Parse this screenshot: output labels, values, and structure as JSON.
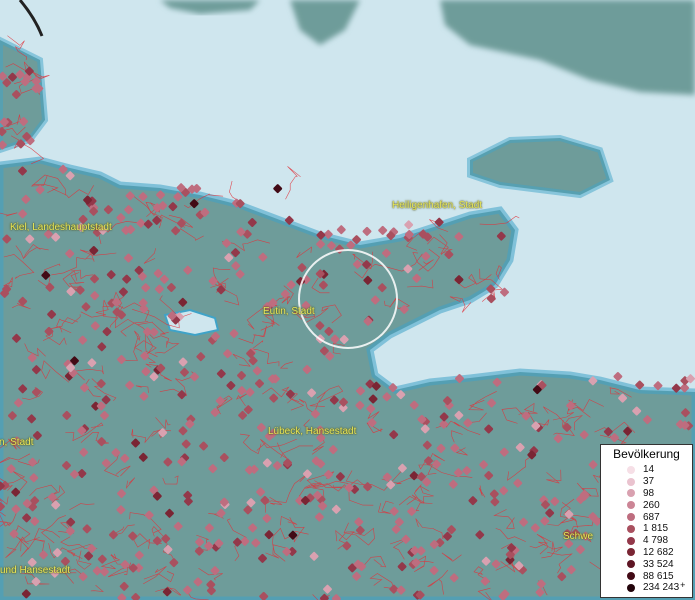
{
  "map": {
    "cities": [
      {
        "label": "Heiligenhafen, Stadt"
      },
      {
        "label": "Kiel, Landeshauptstadt"
      },
      {
        "label": "Eutin, Stadt"
      },
      {
        "label": "Lübeck, Hansestadt"
      },
      {
        "label": "n, Stadt"
      },
      {
        "label": "und Hansestadt"
      },
      {
        "label": "Schwe"
      }
    ],
    "colors": {
      "sea": "#cfe6ee",
      "land": "#6e9c9a",
      "boundary": "#e0323a",
      "marker": "#c9707f"
    }
  },
  "legend": {
    "title": "Bevölkerung",
    "items": [
      {
        "label": "14",
        "color": "#f6dfe6"
      },
      {
        "label": "37",
        "color": "#eac3cf"
      },
      {
        "label": "98",
        "color": "#d9a1b0"
      },
      {
        "label": "260",
        "color": "#cc8596"
      },
      {
        "label": "687",
        "color": "#be6d7f"
      },
      {
        "label": "1 815",
        "color": "#a9505f"
      },
      {
        "label": "4 798",
        "color": "#93384a"
      },
      {
        "label": "12 682",
        "color": "#7a2534"
      },
      {
        "label": "33 524",
        "color": "#5e1524"
      },
      {
        "label": "88 615",
        "color": "#420a15"
      },
      {
        "label": "234 243",
        "color": "#22030a"
      }
    ],
    "plus": "+"
  }
}
